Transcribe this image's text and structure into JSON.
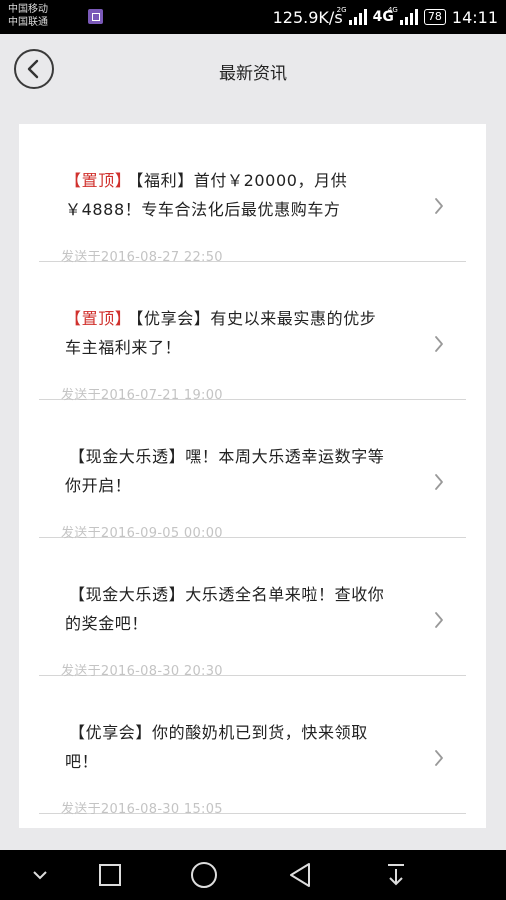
{
  "status_bar": {
    "carrier_1": "中国移动",
    "carrier_2": "中国联通",
    "net_speed": "125.9K/s",
    "sig1_tag": "2G",
    "net_type": "4G",
    "sig2_tag": "4G",
    "battery": "78",
    "time": "14:11"
  },
  "header": {
    "title": "最新资讯",
    "back_icon": "chevron-left-circle-icon"
  },
  "news": [
    {
      "pin": "【置顶】",
      "text": "【福利】首付￥20000，月供￥4888！专车合法化后最优惠购车方",
      "date": "发送于2016-08-27 22:50"
    },
    {
      "pin": "【置顶】",
      "text": "【优享会】有史以来最实惠的优步车主福利来了！",
      "date": "发送于2016-07-21 19:00"
    },
    {
      "pin": "",
      "text": "【现金大乐透】嘿！本周大乐透幸运数字等你开启！",
      "date": "发送于2016-09-05 00:00"
    },
    {
      "pin": "",
      "text": "【现金大乐透】大乐透全名单来啦！查收你的奖金吧！",
      "date": "发送于2016-08-30 20:30"
    },
    {
      "pin": "",
      "text": "【优享会】你的酸奶机已到货，快来领取吧！",
      "date": "发送于2016-08-30 15:05"
    }
  ],
  "nav_bar": {
    "icons": [
      "chevron-down-icon",
      "square-recents-icon",
      "circle-home-icon",
      "triangle-back-icon",
      "download-icon"
    ]
  },
  "colors": {
    "pin_red": "#d0312d",
    "date_gray": "#c4c4c4",
    "background": "#e9e9eb"
  }
}
